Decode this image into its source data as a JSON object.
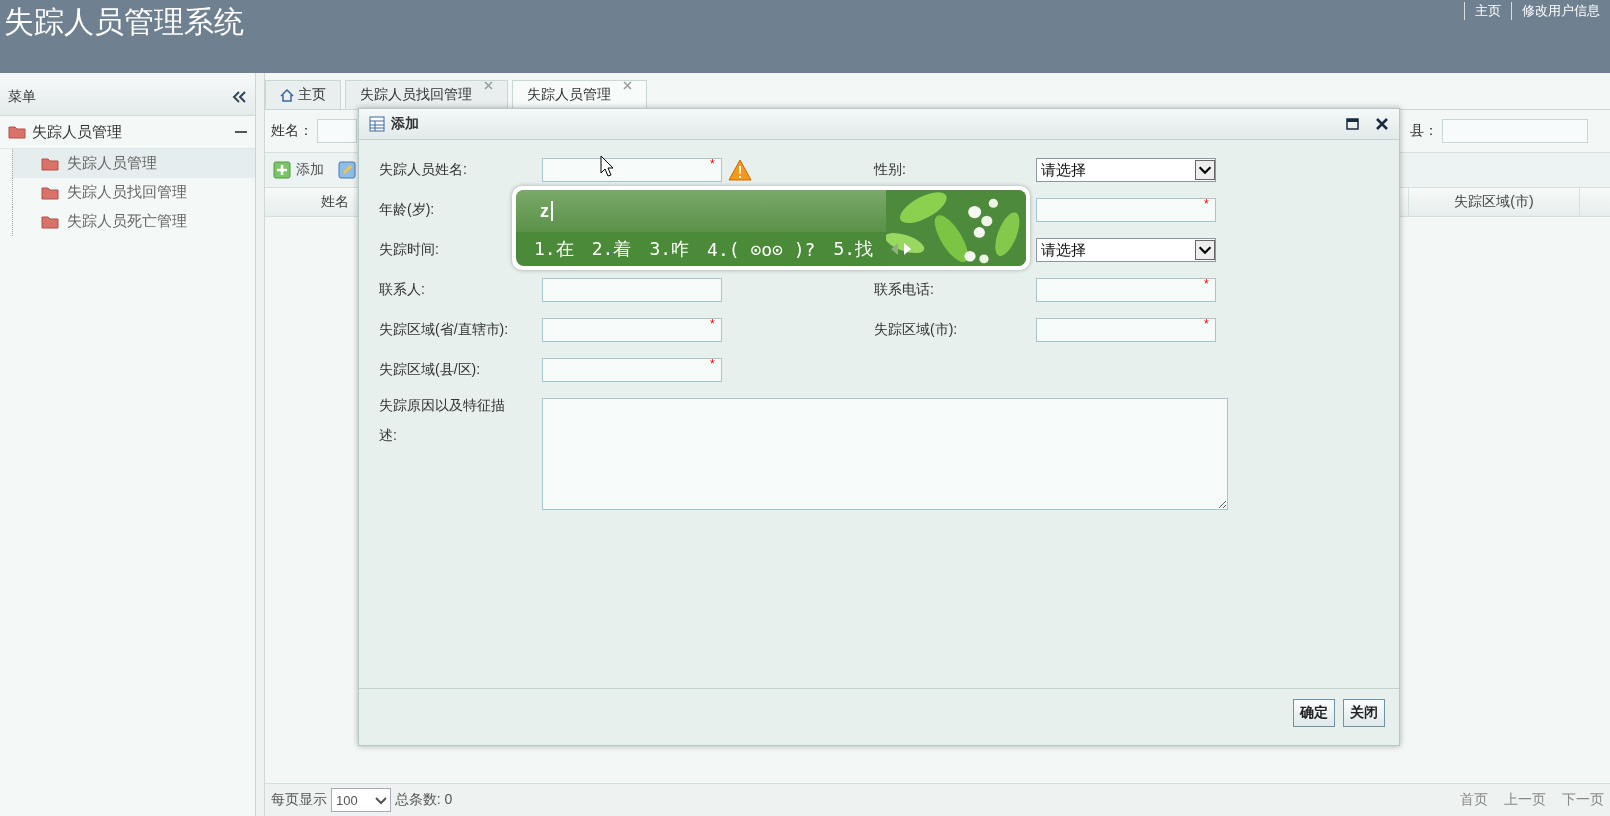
{
  "header": {
    "title": "失踪人员管理系统",
    "links": [
      "主页",
      "修改用户信息"
    ]
  },
  "sidebar": {
    "title": "菜单",
    "groups": [
      {
        "label": "失踪人员管理",
        "expanded": true,
        "children": [
          {
            "label": "失踪人员管理",
            "selected": true
          },
          {
            "label": "失踪人员找回管理",
            "selected": false
          },
          {
            "label": "失踪人员死亡管理",
            "selected": false
          }
        ]
      }
    ]
  },
  "tabs": [
    {
      "label": "主页",
      "kind": "home",
      "selected": false
    },
    {
      "label": "失踪人员找回管理",
      "kind": "closable",
      "selected": false
    },
    {
      "label": "失踪人员管理",
      "kind": "closable",
      "selected": true
    }
  ],
  "search": {
    "left_label": "姓名：",
    "right_label": "县："
  },
  "toolbar": [
    {
      "kind": "add",
      "label": "添加"
    },
    {
      "kind": "edit"
    }
  ],
  "table": {
    "columns": [
      "姓名",
      "失踪区域(市)"
    ]
  },
  "footer": {
    "page_size_label": "每页显示",
    "page_size": "100",
    "total": "总条数: 0",
    "nav": [
      "首页",
      "上一页",
      "下一页"
    ]
  },
  "dialog": {
    "title": "添加",
    "left": [
      {
        "label": "失踪人员姓名:",
        "field": {
          "kind": "text",
          "required_mark": "*",
          "warning": true
        }
      },
      {
        "label": "年龄(岁):"
      },
      {
        "label": "失踪时间:"
      },
      {
        "label": "联系人:",
        "field": {
          "kind": "text"
        }
      },
      {
        "label": "失踪区域(省/直辖市):",
        "field": {
          "kind": "text",
          "required_mark": "*"
        }
      },
      {
        "label": "失踪区域(县/区):",
        "field": {
          "kind": "text",
          "required_mark": "*"
        }
      }
    ],
    "right": [
      {
        "label": "性别:",
        "field": {
          "kind": "select",
          "value": "请选择"
        }
      },
      {
        "field": {
          "kind": "text",
          "required_mark": "*"
        }
      },
      {
        "field": {
          "kind": "select",
          "value": "请选择"
        }
      },
      {
        "label": "联系电话:",
        "field": {
          "kind": "text",
          "required_mark": "*"
        }
      },
      {
        "label": "失踪区域(市):",
        "field": {
          "kind": "text",
          "required_mark": "*"
        }
      }
    ],
    "description": {
      "label": "失踪原因以及特征描述:"
    },
    "buttons": [
      "确定",
      "关闭"
    ]
  },
  "ime": {
    "composition": "z",
    "candidates": [
      "1.在",
      "2.着",
      "3.咋",
      "4.( ⊙o⊙ )?",
      "5.找"
    ]
  }
}
